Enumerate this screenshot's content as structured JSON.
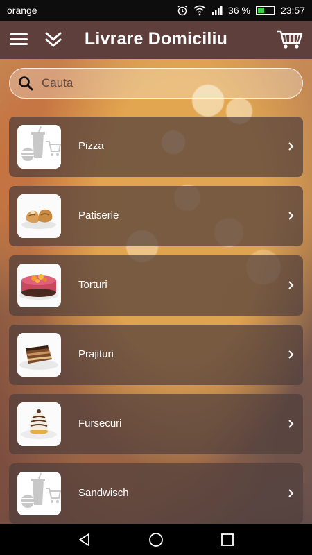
{
  "status_bar": {
    "carrier": "orange",
    "battery_percent": "36 %",
    "time": "23:57",
    "icons": [
      "alarm-icon",
      "wifi-icon",
      "signal-icon",
      "battery-icon"
    ]
  },
  "app_bar": {
    "title": "Livrare Domiciliu",
    "icons": [
      "menu-icon",
      "chevron-double-down-icon",
      "cart-icon"
    ]
  },
  "search": {
    "placeholder": "Cauta",
    "value": ""
  },
  "categories": [
    {
      "label": "Pizza",
      "image": "placeholder-shop-icon"
    },
    {
      "label": "Patiserie",
      "image": "pastry-photo"
    },
    {
      "label": "Torturi",
      "image": "cake-photo"
    },
    {
      "label": "Prajituri",
      "image": "slice-cake-photo"
    },
    {
      "label": "Fursecuri",
      "image": "dessert-dome-photo"
    },
    {
      "label": "Sandwisch",
      "image": "placeholder-shop-icon"
    }
  ],
  "colors": {
    "app_bar": "#5e3f3c",
    "list_item_bg": "rgba(80,62,60,0.72)",
    "text": "#ffffff"
  }
}
